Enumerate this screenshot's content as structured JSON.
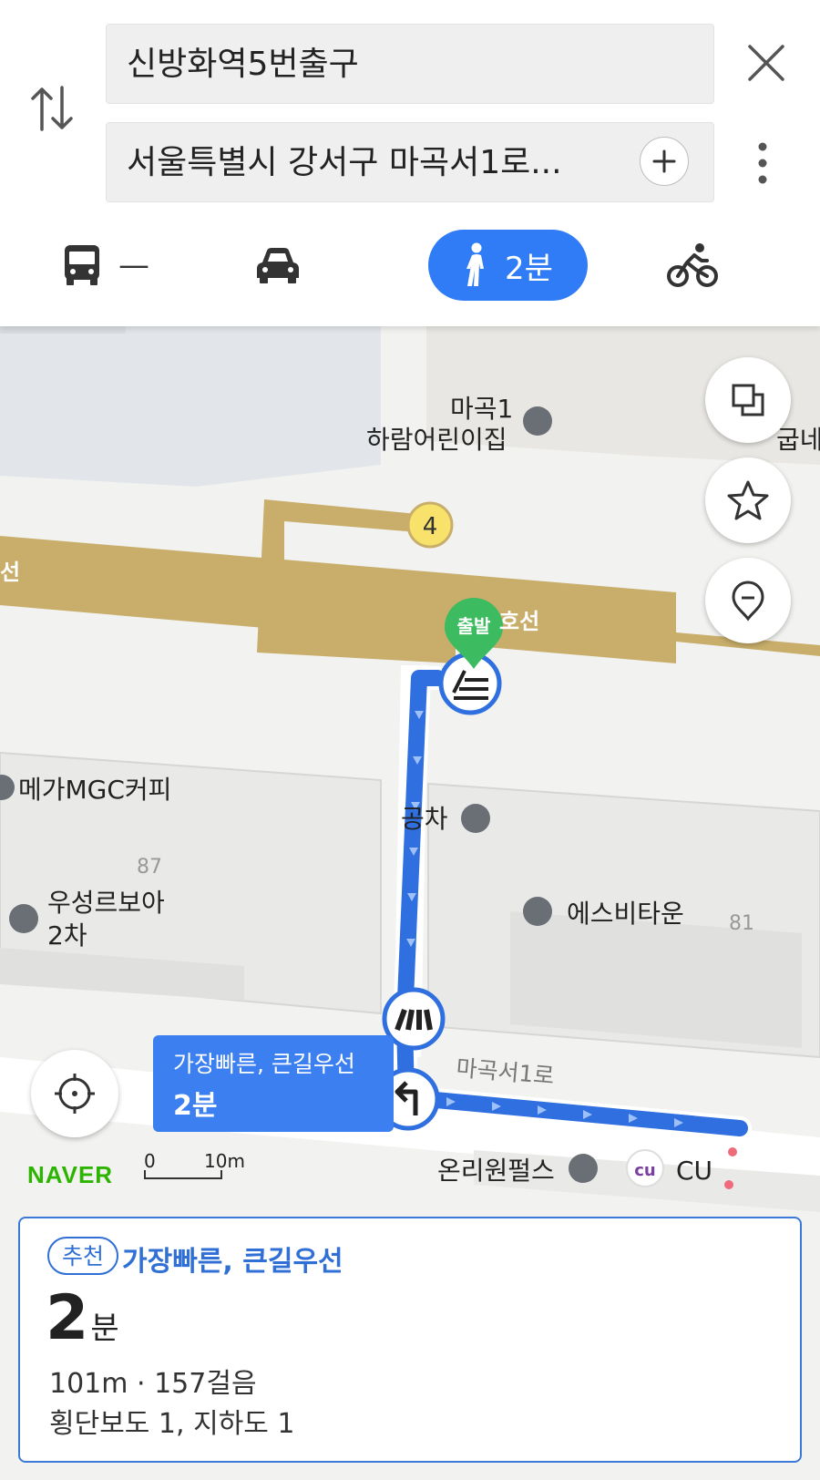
{
  "search": {
    "origin": "신방화역5번출구",
    "destination": "서울특별시 강서구 마곡서1로..."
  },
  "modes": {
    "bus_label": "—",
    "walk_label": "2분"
  },
  "map": {
    "labels": {
      "daycare": "마곡1",
      "daycare2": "하람어린이집",
      "subway_number": "4",
      "start_pin": "출발",
      "line_label_right": "호선",
      "line_label_left": "선",
      "gongcha": "공차",
      "mega": "메가MGC커피",
      "bldg_87": "87",
      "woosung1": "우성르보아",
      "woosung2": "2차",
      "sbtown": "에스비타운",
      "bldg_81": "81",
      "road": "마곡서1로",
      "oriwon": "온리원펄스",
      "cu_logo": "cu",
      "cu": "CU",
      "edge_right": "굽네"
    },
    "callout": {
      "name": "가장빠른, 큰길우선",
      "time": "2분"
    },
    "logo": "NAVER",
    "scale_zero": "0",
    "scale_dist": "10m"
  },
  "summary": {
    "badge": "추천",
    "title": "가장빠른, 큰길우선",
    "time_value": "2",
    "time_unit": "분",
    "distance": "101m · 157걸음",
    "crossings": "횡단보도 1, 지하도 1"
  },
  "colors": {
    "accent": "#2f7cf6",
    "route": "#2f6fe0",
    "subway_line": "#c8ae6a",
    "start_pin": "#3dbb61",
    "naver_green": "#2db400"
  }
}
